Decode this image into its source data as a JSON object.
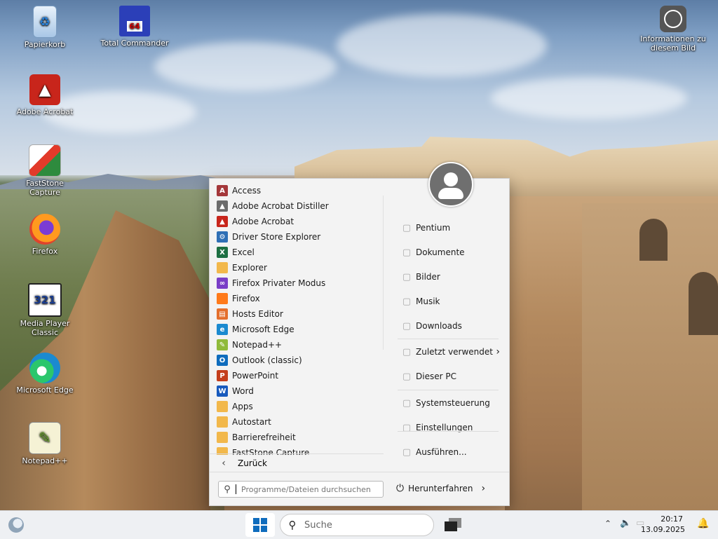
{
  "desktop": {
    "icons": [
      {
        "label": "Papierkorb",
        "icon": "recycle-bin-icon"
      },
      {
        "label": "Total Commander",
        "icon": "floppy-disk-icon",
        "badge": "64"
      },
      {
        "label": "Informationen zu diesem Bild",
        "icon": "camera-icon"
      },
      {
        "label": "Adobe Acrobat",
        "icon": "acrobat-icon"
      },
      {
        "label": "FastStone Capture",
        "icon": "faststone-icon"
      },
      {
        "label": "Firefox",
        "icon": "firefox-icon"
      },
      {
        "label": "Media Player Classic",
        "icon": "media-player-icon",
        "badge": "321"
      },
      {
        "label": "Microsoft Edge",
        "icon": "edge-icon"
      },
      {
        "label": "Notepad++",
        "icon": "notepad-plus-plus-icon"
      }
    ]
  },
  "start_menu": {
    "apps": [
      {
        "label": "Access",
        "icon": "access-icon",
        "letter": "A",
        "color": "#a4373a"
      },
      {
        "label": "Adobe Acrobat Distiller",
        "icon": "acrobat-distiller-icon",
        "letter": "▲",
        "color": "#6b6b6b"
      },
      {
        "label": "Adobe Acrobat",
        "icon": "acrobat-icon",
        "letter": "▲",
        "color": "#c8251b"
      },
      {
        "label": "Driver Store Explorer",
        "icon": "gear-icon",
        "letter": "⚙",
        "color": "#2f6fb5"
      },
      {
        "label": "Excel",
        "icon": "excel-icon",
        "letter": "X",
        "color": "#1d6f42"
      },
      {
        "label": "Explorer",
        "icon": "folder-icon",
        "letter": "",
        "color": "#f2b84b"
      },
      {
        "label": "Firefox Privater Modus",
        "icon": "firefox-private-icon",
        "letter": "∞",
        "color": "#7a3ec7"
      },
      {
        "label": "Firefox",
        "icon": "firefox-icon",
        "letter": "",
        "color": "#ff7a1a"
      },
      {
        "label": "Hosts Editor",
        "icon": "hosts-editor-icon",
        "letter": "▤",
        "color": "#e46f2c"
      },
      {
        "label": "Microsoft Edge",
        "icon": "edge-icon",
        "letter": "e",
        "color": "#1b8ad0"
      },
      {
        "label": "Notepad++",
        "icon": "notepad-plus-plus-icon",
        "letter": "✎",
        "color": "#8fba3a"
      },
      {
        "label": "Outlook (classic)",
        "icon": "outlook-icon",
        "letter": "O",
        "color": "#0f6cbd"
      },
      {
        "label": "PowerPoint",
        "icon": "powerpoint-icon",
        "letter": "P",
        "color": "#c43e1c"
      },
      {
        "label": "Word",
        "icon": "word-icon",
        "letter": "W",
        "color": "#185abd"
      },
      {
        "label": "Apps",
        "icon": "apps-folder-icon",
        "letter": "",
        "color": "#f2b84b"
      },
      {
        "label": "Autostart",
        "icon": "folder-icon",
        "letter": "",
        "color": "#f2b84b"
      },
      {
        "label": "Barrierefreiheit",
        "icon": "folder-icon",
        "letter": "",
        "color": "#f2b84b"
      },
      {
        "label": "FastStone Capture",
        "icon": "folder-icon",
        "letter": "",
        "color": "#f2b84b"
      }
    ],
    "back_label": "Zurück",
    "right_items": [
      {
        "label": "Pentium",
        "icon": "user-folder-icon"
      },
      {
        "label": "Dokumente",
        "icon": "document-icon"
      },
      {
        "label": "Bilder",
        "icon": "image-icon"
      },
      {
        "label": "Musik",
        "icon": "music-icon"
      },
      {
        "label": "Downloads",
        "icon": "download-icon"
      },
      {
        "label": "Zuletzt verwendet",
        "icon": "clock-icon",
        "submenu": true
      },
      {
        "label": "Dieser PC",
        "icon": "computer-icon"
      },
      {
        "label": "Systemsteuerung",
        "icon": "control-panel-icon"
      },
      {
        "label": "Einstellungen",
        "icon": "settings-icon"
      },
      {
        "label": "Ausführen...",
        "icon": "run-icon"
      }
    ],
    "search_placeholder": "Programme/Dateien durchsuchen",
    "power_label": "Herunterfahren"
  },
  "taskbar": {
    "search_placeholder": "Suche",
    "time": "20:17",
    "date": "13.09.2025"
  }
}
